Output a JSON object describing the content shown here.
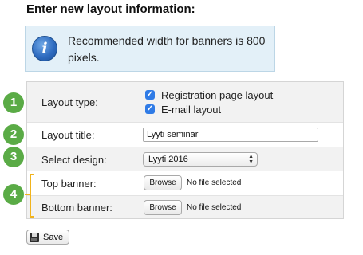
{
  "page": {
    "title": "Enter new layout information:"
  },
  "info": {
    "icon": "info-icon",
    "text": "Recommended width for banners is 800 pixels."
  },
  "form": {
    "layout_type": {
      "label": "Layout type:",
      "options": [
        {
          "label": "Registration page layout",
          "checked": true
        },
        {
          "label": "E-mail layout",
          "checked": true
        }
      ]
    },
    "layout_title": {
      "label": "Layout title:",
      "value": "Lyyti seminar"
    },
    "design": {
      "label": "Select design:",
      "selected": "Lyyti 2016"
    },
    "top_banner": {
      "label": "Top banner:",
      "button": "Browse",
      "status": "No file selected"
    },
    "bottom_banner": {
      "label": "Bottom banner:",
      "button": "Browse",
      "status": "No file selected"
    }
  },
  "markers": [
    "1",
    "2",
    "3",
    "4"
  ],
  "colors": {
    "marker": "#5aab46",
    "bracket": "#f1b31c",
    "info_bg": "#e3f0f8",
    "checkbox": "#2f7be6"
  },
  "save": {
    "label": "Save",
    "icon": "floppy-disk-icon"
  }
}
